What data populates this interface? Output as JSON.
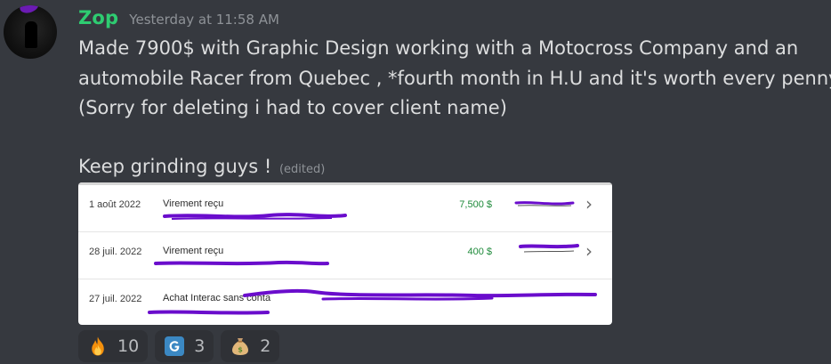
{
  "message": {
    "username": "Zop",
    "timestamp": "Yesterday at 11:58 AM",
    "lines": [
      "Made 7900$ with Graphic Design working with a Motocross Company and an",
      "automobile Racer from Quebec , *fourth month in H.U and it's worth every penny",
      "(Sorry for deleting i had to cover client name)",
      "Keep grinding guys !"
    ],
    "edited_label": "(edited)",
    "username_color": "#2ecc71"
  },
  "attachment": {
    "transactions": [
      {
        "date": "1 août 2022",
        "description": "Virement reçu",
        "amount": "7,500 $"
      },
      {
        "date": "28 juil. 2022",
        "description": "Virement reçu",
        "amount": "400 $"
      },
      {
        "date": "27 juil. 2022",
        "description": "Achat Interac sans conta",
        "amount": ""
      }
    ],
    "amount_color": "#1e8a3a",
    "redaction_color": "#6a0dcc"
  },
  "reactions": [
    {
      "icon": "fire-icon",
      "count": "10"
    },
    {
      "icon": "g-letter-icon",
      "count": "3"
    },
    {
      "icon": "money-bag-icon",
      "count": "2"
    }
  ]
}
